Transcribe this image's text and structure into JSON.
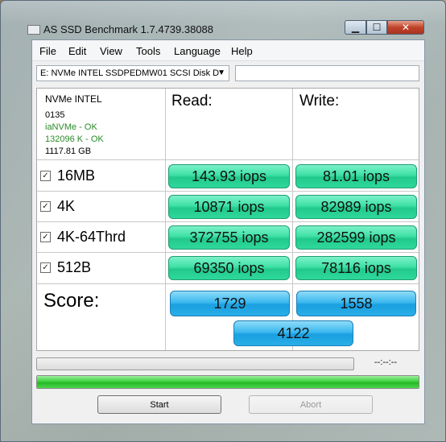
{
  "window": {
    "title": "AS SSD Benchmark 1.7.4739.38088"
  },
  "menu": [
    "File",
    "Edit",
    "View",
    "Tools",
    "Language",
    "Help"
  ],
  "drive_select": {
    "value": "E: NVMe INTEL SSDPEDMW01 SCSI Disk D"
  },
  "info": {
    "model": "NVMe INTEL",
    "firmware": "0135",
    "driver": "iaNVMe - OK",
    "alignment": "132096 K - OK",
    "size": "1117.81 GB"
  },
  "columns": {
    "read": "Read:",
    "write": "Write:"
  },
  "rows": [
    {
      "label": "16MB",
      "checked": true,
      "read": "143.93 iops",
      "write": "81.01 iops"
    },
    {
      "label": "4K",
      "checked": true,
      "read": "10871 iops",
      "write": "82989 iops"
    },
    {
      "label": "4K-64Thrd",
      "checked": true,
      "read": "372755 iops",
      "write": "282599 iops"
    },
    {
      "label": "512B",
      "checked": true,
      "read": "69350 iops",
      "write": "78116 iops"
    }
  ],
  "score": {
    "label": "Score:",
    "read": "1729",
    "write": "1558",
    "total": "4122"
  },
  "progress": {
    "time": "--:--:--",
    "overall_fraction": 1.0
  },
  "buttons": {
    "start": "Start",
    "abort": "Abort"
  },
  "colors": {
    "result_green": "#3ee0a6",
    "score_blue": "#3bb8ef",
    "progress_green": "#3ed23e"
  }
}
